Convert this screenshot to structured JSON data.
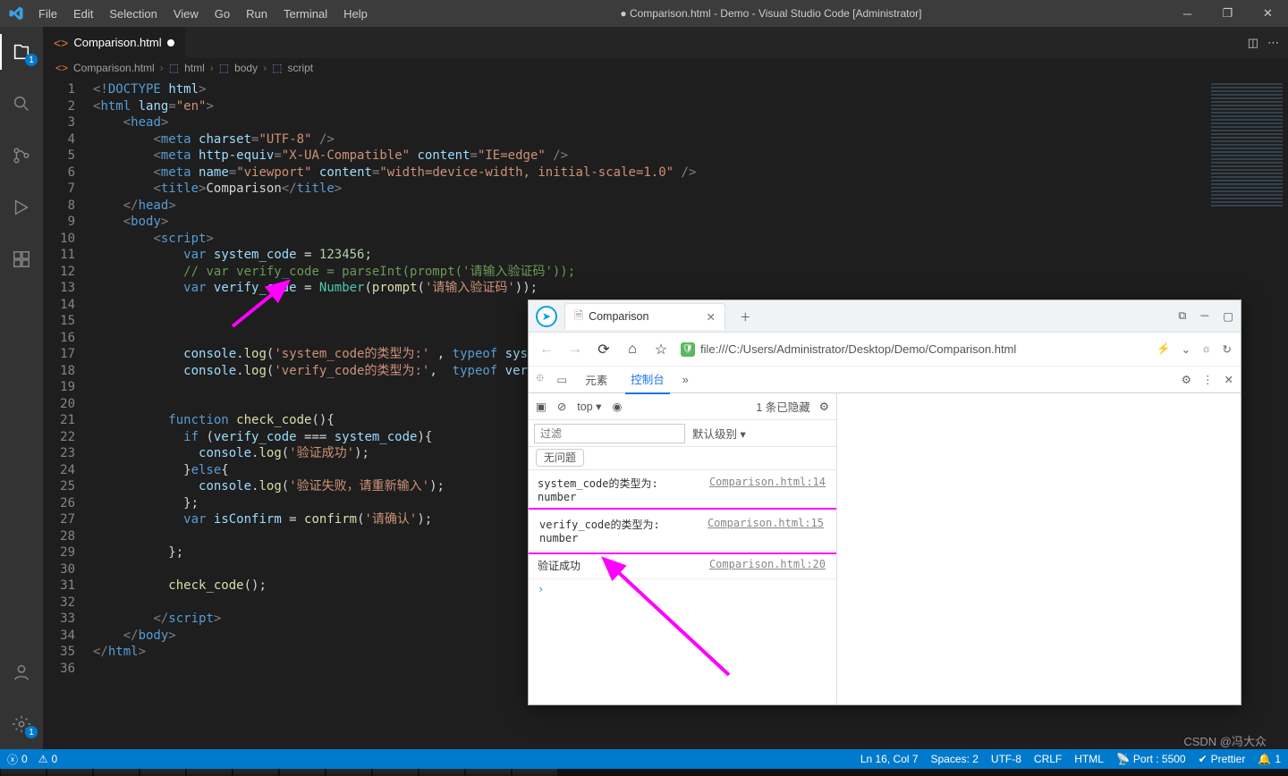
{
  "titlebar": {
    "menus": [
      "File",
      "Edit",
      "Selection",
      "View",
      "Go",
      "Run",
      "Terminal",
      "Help"
    ],
    "title": "● Comparison.html - Demo - Visual Studio Code [Administrator]"
  },
  "activitybar": {
    "explorer_badge": "1",
    "gear_badge": "1"
  },
  "tab": {
    "label": "Comparison.html"
  },
  "breadcrumb": {
    "file": "Comparison.html",
    "parts": [
      "html",
      "body",
      "script"
    ]
  },
  "code": {
    "lines": [
      [
        [
          "t-pun",
          "<!"
        ],
        [
          "t-tag",
          "DOCTYPE"
        ],
        [
          "t-op",
          " "
        ],
        [
          "t-attr",
          "html"
        ],
        [
          "t-pun",
          ">"
        ]
      ],
      [
        [
          "t-pun",
          "<"
        ],
        [
          "t-tag",
          "html"
        ],
        [
          "t-op",
          " "
        ],
        [
          "t-attr",
          "lang"
        ],
        [
          "t-pun",
          "="
        ],
        [
          "t-str",
          "\"en\""
        ],
        [
          "t-pun",
          ">"
        ]
      ],
      [
        [
          "t-op",
          "    "
        ],
        [
          "t-pun",
          "<"
        ],
        [
          "t-tag",
          "head"
        ],
        [
          "t-pun",
          ">"
        ]
      ],
      [
        [
          "t-op",
          "        "
        ],
        [
          "t-pun",
          "<"
        ],
        [
          "t-tag",
          "meta"
        ],
        [
          "t-op",
          " "
        ],
        [
          "t-attr",
          "charset"
        ],
        [
          "t-pun",
          "="
        ],
        [
          "t-str",
          "\"UTF-8\""
        ],
        [
          "t-op",
          " "
        ],
        [
          "t-pun",
          "/>"
        ]
      ],
      [
        [
          "t-op",
          "        "
        ],
        [
          "t-pun",
          "<"
        ],
        [
          "t-tag",
          "meta"
        ],
        [
          "t-op",
          " "
        ],
        [
          "t-attr",
          "http-equiv"
        ],
        [
          "t-pun",
          "="
        ],
        [
          "t-str",
          "\"X-UA-Compatible\""
        ],
        [
          "t-op",
          " "
        ],
        [
          "t-attr",
          "content"
        ],
        [
          "t-pun",
          "="
        ],
        [
          "t-str",
          "\"IE=edge\""
        ],
        [
          "t-op",
          " "
        ],
        [
          "t-pun",
          "/>"
        ]
      ],
      [
        [
          "t-op",
          "        "
        ],
        [
          "t-pun",
          "<"
        ],
        [
          "t-tag",
          "meta"
        ],
        [
          "t-op",
          " "
        ],
        [
          "t-attr",
          "name"
        ],
        [
          "t-pun",
          "="
        ],
        [
          "t-str",
          "\"viewport\""
        ],
        [
          "t-op",
          " "
        ],
        [
          "t-attr",
          "content"
        ],
        [
          "t-pun",
          "="
        ],
        [
          "t-str",
          "\"width=device-width, initial-scale=1.0\""
        ],
        [
          "t-op",
          " "
        ],
        [
          "t-pun",
          "/>"
        ]
      ],
      [
        [
          "t-op",
          "        "
        ],
        [
          "t-pun",
          "<"
        ],
        [
          "t-tag",
          "title"
        ],
        [
          "t-pun",
          ">"
        ],
        [
          "t-op",
          "Comparison"
        ],
        [
          "t-pun",
          "</"
        ],
        [
          "t-tag",
          "title"
        ],
        [
          "t-pun",
          ">"
        ]
      ],
      [
        [
          "t-op",
          "    "
        ],
        [
          "t-pun",
          "</"
        ],
        [
          "t-tag",
          "head"
        ],
        [
          "t-pun",
          ">"
        ]
      ],
      [
        [
          "t-op",
          "    "
        ],
        [
          "t-pun",
          "<"
        ],
        [
          "t-tag",
          "body"
        ],
        [
          "t-pun",
          ">"
        ]
      ],
      [
        [
          "t-op",
          "        "
        ],
        [
          "t-pun",
          "<"
        ],
        [
          "t-tag",
          "script"
        ],
        [
          "t-pun",
          ">"
        ]
      ],
      [
        [
          "t-op",
          "            "
        ],
        [
          "t-kw",
          "var"
        ],
        [
          "t-op",
          " "
        ],
        [
          "t-var",
          "system_code"
        ],
        [
          "t-op",
          " = "
        ],
        [
          "t-num",
          "123456"
        ],
        [
          "t-op",
          ";"
        ]
      ],
      [
        [
          "t-op",
          "            "
        ],
        [
          "t-cmt",
          "// var verify_code = parseInt(prompt('请输入验证码'));"
        ]
      ],
      [
        [
          "t-op",
          "            "
        ],
        [
          "t-kw",
          "var"
        ],
        [
          "t-op",
          " "
        ],
        [
          "t-var",
          "verify_code"
        ],
        [
          "t-op",
          " = "
        ],
        [
          "t-cls",
          "Number"
        ],
        [
          "t-op",
          "("
        ],
        [
          "t-fn",
          "prompt"
        ],
        [
          "t-op",
          "("
        ],
        [
          "t-str",
          "'请输入验证码'"
        ],
        [
          "t-op",
          "));"
        ]
      ],
      [
        [
          "t-op",
          ""
        ]
      ],
      [
        [
          "t-op",
          ""
        ]
      ],
      [
        [
          "t-op",
          ""
        ]
      ],
      [
        [
          "t-op",
          "            "
        ],
        [
          "t-var",
          "console"
        ],
        [
          "t-op",
          "."
        ],
        [
          "t-fn",
          "log"
        ],
        [
          "t-op",
          "("
        ],
        [
          "t-str",
          "'system_code的类型为:'"
        ],
        [
          "t-op",
          " , "
        ],
        [
          "t-kw",
          "typeof"
        ],
        [
          "t-op",
          " "
        ],
        [
          "t-var",
          "system_code"
        ],
        [
          "t-op",
          ");"
        ]
      ],
      [
        [
          "t-op",
          "            "
        ],
        [
          "t-var",
          "console"
        ],
        [
          "t-op",
          "."
        ],
        [
          "t-fn",
          "log"
        ],
        [
          "t-op",
          "("
        ],
        [
          "t-str",
          "'verify_code的类型为:'"
        ],
        [
          "t-op",
          ",  "
        ],
        [
          "t-kw",
          "typeof"
        ],
        [
          "t-op",
          " "
        ],
        [
          "t-var",
          "verify_code"
        ],
        [
          "t-op",
          ");"
        ]
      ],
      [
        [
          "t-op",
          ""
        ]
      ],
      [
        [
          "t-op",
          ""
        ]
      ],
      [
        [
          "t-op",
          "          "
        ],
        [
          "t-kw",
          "function"
        ],
        [
          "t-op",
          " "
        ],
        [
          "t-fn",
          "check_code"
        ],
        [
          "t-op",
          "(){"
        ]
      ],
      [
        [
          "t-op",
          "            "
        ],
        [
          "t-kw",
          "if"
        ],
        [
          "t-op",
          " ("
        ],
        [
          "t-var",
          "verify_code"
        ],
        [
          "t-op",
          " === "
        ],
        [
          "t-var",
          "system_code"
        ],
        [
          "t-op",
          "){"
        ]
      ],
      [
        [
          "t-op",
          "              "
        ],
        [
          "t-var",
          "console"
        ],
        [
          "t-op",
          "."
        ],
        [
          "t-fn",
          "log"
        ],
        [
          "t-op",
          "("
        ],
        [
          "t-str",
          "'验证成功'"
        ],
        [
          "t-op",
          ");"
        ]
      ],
      [
        [
          "t-op",
          "            }"
        ],
        [
          "t-kw",
          "else"
        ],
        [
          "t-op",
          "{"
        ]
      ],
      [
        [
          "t-op",
          "              "
        ],
        [
          "t-var",
          "console"
        ],
        [
          "t-op",
          "."
        ],
        [
          "t-fn",
          "log"
        ],
        [
          "t-op",
          "("
        ],
        [
          "t-str",
          "'验证失败，请重新输入'"
        ],
        [
          "t-op",
          ");"
        ]
      ],
      [
        [
          "t-op",
          "            };"
        ]
      ],
      [
        [
          "t-op",
          "            "
        ],
        [
          "t-kw",
          "var"
        ],
        [
          "t-op",
          " "
        ],
        [
          "t-var",
          "isConfirm"
        ],
        [
          "t-op",
          " = "
        ],
        [
          "t-fn",
          "confirm"
        ],
        [
          "t-op",
          "("
        ],
        [
          "t-str",
          "'请确认'"
        ],
        [
          "t-op",
          ");"
        ]
      ],
      [
        [
          "t-op",
          ""
        ]
      ],
      [
        [
          "t-op",
          "          };"
        ]
      ],
      [
        [
          "t-op",
          ""
        ]
      ],
      [
        [
          "t-op",
          "          "
        ],
        [
          "t-fn",
          "check_code"
        ],
        [
          "t-op",
          "();"
        ]
      ],
      [
        [
          "t-op",
          ""
        ]
      ],
      [
        [
          "t-op",
          "        "
        ],
        [
          "t-pun",
          "</"
        ],
        [
          "t-tag",
          "script"
        ],
        [
          "t-pun",
          ">"
        ]
      ],
      [
        [
          "t-op",
          "    "
        ],
        [
          "t-pun",
          "</"
        ],
        [
          "t-tag",
          "body"
        ],
        [
          "t-pun",
          ">"
        ]
      ],
      [
        [
          "t-pun",
          "</"
        ],
        [
          "t-tag",
          "html"
        ],
        [
          "t-pun",
          ">"
        ]
      ],
      [
        [
          "t-op",
          ""
        ]
      ]
    ]
  },
  "statusbar": {
    "errors": "0",
    "warnings": "0",
    "cursor": "Ln 16, Col 7",
    "spaces": "Spaces: 2",
    "encoding": "UTF-8",
    "eol": "CRLF",
    "lang": "HTML",
    "port": "Port : 5500",
    "prettier": "Prettier",
    "notif": "1"
  },
  "browser": {
    "tab_title": "Comparison",
    "url": "file:///C:/Users/Administrator/Desktop/Demo/Comparison.html",
    "devtools": {
      "tab_elements": "元素",
      "tab_console": "控制台",
      "top": "top",
      "hidden": "1 条已隐藏",
      "filter_placeholder": "过滤",
      "level": "默认级别",
      "no_issues": "无问题"
    },
    "console": [
      {
        "msg": "system_code的类型为:",
        "val": "number",
        "src": "Comparison.html:14",
        "hl": false
      },
      {
        "msg": "verify_code的类型为:",
        "val": "number",
        "src": "Comparison.html:15",
        "hl": true
      },
      {
        "msg": "验证成功",
        "val": "",
        "src": "Comparison.html:20",
        "hl": false
      }
    ]
  },
  "watermark": "CSDN @冯大众"
}
